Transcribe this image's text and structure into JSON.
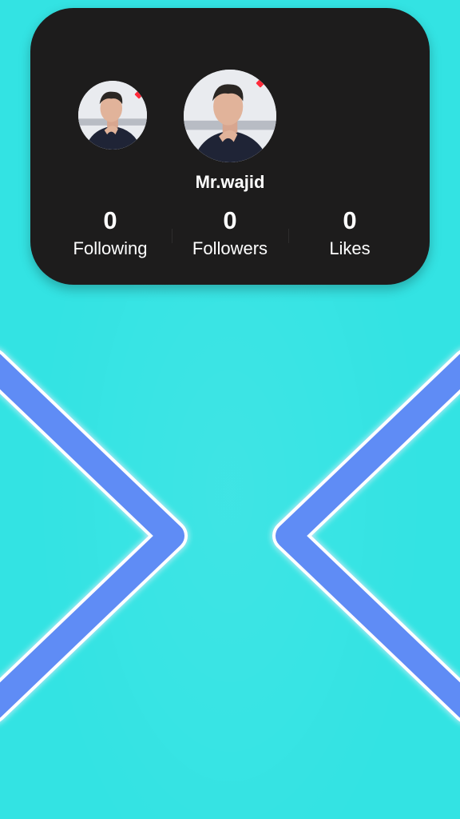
{
  "profile": {
    "username": "Mr.wajid",
    "avatar_small": "profile-photo",
    "avatar_large": "profile-photo"
  },
  "stats": {
    "following": {
      "value": "0",
      "label": "Following"
    },
    "followers": {
      "value": "0",
      "label": "Followers"
    },
    "likes": {
      "value": "0",
      "label": "Likes"
    }
  },
  "colors": {
    "background": "#33e3e3",
    "card": "#1d1c1c",
    "chevron": "#5f8cf5",
    "badge": "#ff2a3a"
  }
}
